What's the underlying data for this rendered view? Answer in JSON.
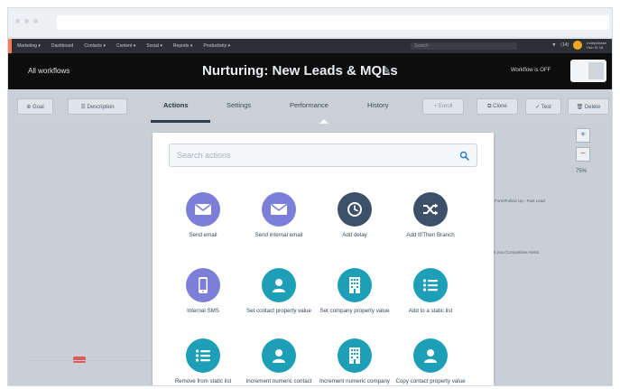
{
  "topnav": {
    "items": [
      "Marketing ▾",
      "Dashboard",
      "Contacts ▾",
      "Content ▾",
      "Social ▾",
      "Reports ▾",
      "Productivity ▾"
    ],
    "search_placeholder": "Search",
    "notification_count": "(14)",
    "user_name": "Indepolease",
    "user_sub": "Hub ID 18"
  },
  "titlebar": {
    "back_link": "All workflows",
    "title": "Nurturing: New Leads & MQLs",
    "status": "Workflow is OFF"
  },
  "subnav": {
    "goal_label": "⊕ Goal",
    "description_label": "☰ Description",
    "tabs": [
      "Actions",
      "Settings",
      "Performance",
      "History"
    ],
    "enroll_label": "+ Enroll",
    "clone_label": "⧉ Clone",
    "test_label": "✓ Test",
    "delete_label": "🗑 Delete"
  },
  "canvas": {
    "zoom_in": "+",
    "zoom_out": "−",
    "zoom_level": "75%",
    "bg_text_1": "Ideal Form/Follow Up - Fast Lead",
    "bg_text_2": "Thank you (Competitive Alerts",
    "bg_text_3": "Re"
  },
  "search": {
    "placeholder": "Search actions"
  },
  "actions": [
    {
      "label": "Send email",
      "icon": "envelope-icon",
      "color": "#7b7fd8"
    },
    {
      "label": "Send internal email",
      "icon": "envelope-icon",
      "color": "#7b7fd8"
    },
    {
      "label": "Add delay",
      "icon": "clock-icon",
      "color": "#3d5069"
    },
    {
      "label": "Add If/Then Branch",
      "icon": "shuffle-icon",
      "color": "#3d5069"
    },
    {
      "label": "Internal SMS",
      "icon": "phone-icon",
      "color": "#7b7fd8"
    },
    {
      "label": "Set contact property value",
      "icon": "person-icon",
      "color": "#1e9fb8"
    },
    {
      "label": "Set company property value",
      "icon": "building-icon",
      "color": "#1e9fb8"
    },
    {
      "label": "Add to a static list",
      "icon": "list-icon",
      "color": "#1e9fb8"
    },
    {
      "label": "Remove from static list",
      "icon": "list-icon",
      "color": "#1e9fb8"
    },
    {
      "label": "Increment numeric contact property",
      "icon": "person-icon",
      "color": "#1e9fb8"
    },
    {
      "label": "Increment numeric company property",
      "icon": "building-icon",
      "color": "#1e9fb8"
    },
    {
      "label": "Copy contact property value",
      "icon": "person-icon",
      "color": "#1e9fb8"
    }
  ]
}
